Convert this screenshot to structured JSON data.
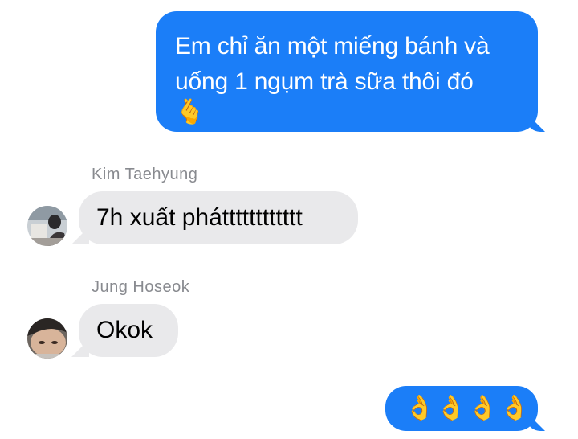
{
  "messages": [
    {
      "direction": "outgoing",
      "text": "Em chỉ ăn một miếng bánh và uống 1 ngụm trà sữa thôi đó",
      "emoji": "🫰",
      "emoji_icon": "finger-heart-icon"
    },
    {
      "direction": "incoming",
      "sender": "Kim Taehyung",
      "avatar_icon": "avatar-kim-taehyung",
      "text": "7h xuất phátttttttttttt"
    },
    {
      "direction": "incoming",
      "sender": "Jung Hoseok",
      "avatar_icon": "avatar-jung-hoseok",
      "text": "Okok"
    },
    {
      "direction": "outgoing",
      "text": "👌👌👌👌",
      "emoji_icon": "ok-hand-icon"
    }
  ],
  "colors": {
    "outgoing_bubble": "#1b7ef8",
    "incoming_bubble": "#e9e9eb",
    "sender_name": "#888a8f"
  }
}
